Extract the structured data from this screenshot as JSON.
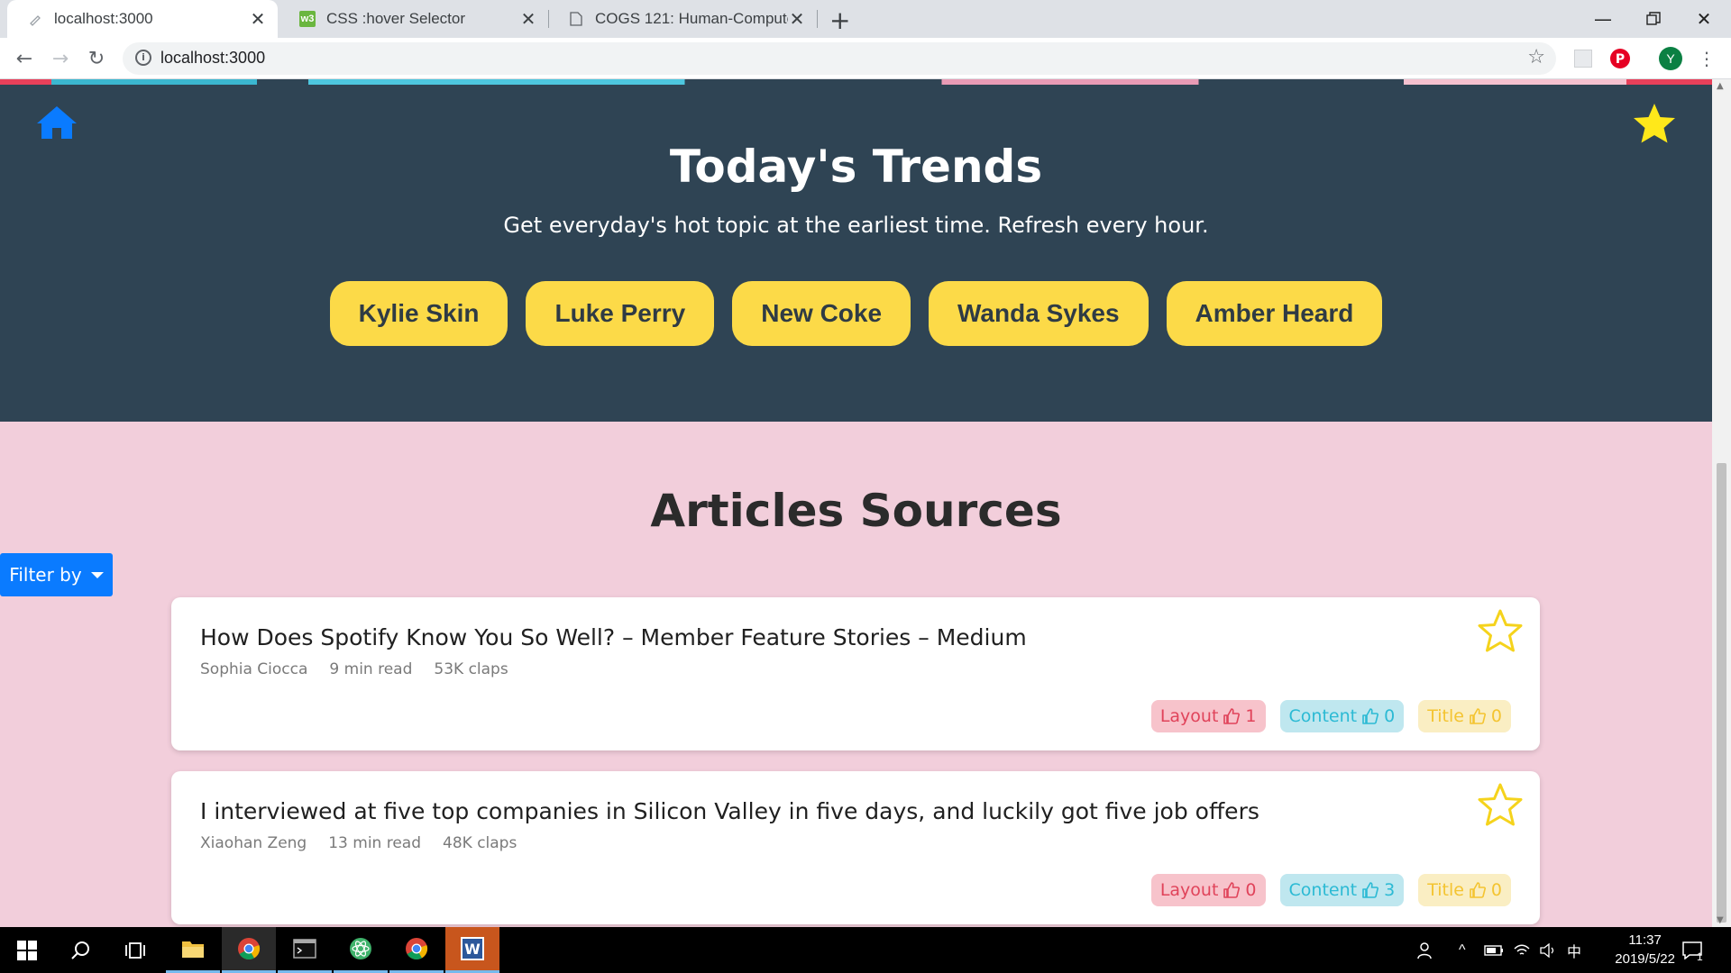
{
  "browser": {
    "tabs": [
      {
        "title": "localhost:3000"
      },
      {
        "title": "CSS :hover Selector"
      },
      {
        "title": "COGS 121: Human-Computer"
      }
    ],
    "url": "localhost:3000",
    "profile_initial": "Y"
  },
  "hero": {
    "title": "Today's Trends",
    "subtitle": "Get everyday's hot topic at the earliest time. Refresh every hour.",
    "trends": [
      "Kylie Skin",
      "Luke Perry",
      "New Coke",
      "Wanda Sykes",
      "Amber Heard"
    ]
  },
  "articles": {
    "section_title": "Articles Sources",
    "filter_label": "Filter by",
    "items": [
      {
        "title": "How Does Spotify Know You So Well? – Member Feature Stories – Medium",
        "author": "Sophia Ciocca",
        "read_time": "9 min read",
        "claps": "53K claps",
        "votes": {
          "layout_label": "Layout",
          "layout": "1",
          "content_label": "Content",
          "content": "0",
          "title_label": "Title",
          "title": "0"
        }
      },
      {
        "title": "I interviewed at five top companies in Silicon Valley in five days, and luckily got five job offers",
        "author": "Xiaohan Zeng",
        "read_time": "13 min read",
        "claps": "48K claps",
        "votes": {
          "layout_label": "Layout",
          "layout": "0",
          "content_label": "Content",
          "content": "3",
          "title_label": "Title",
          "title": "0"
        }
      }
    ]
  },
  "taskbar": {
    "time": "11:37",
    "date": "2019/5/22",
    "ime": "中",
    "notification_count": "1"
  },
  "colors": {
    "hero_bg": "#2f4454",
    "page_bg": "#f2cedb",
    "trend_button": "#fcda48",
    "home_icon": "#0a7bff",
    "star_filled": "#ffe81a",
    "star_outline": "#f5d31c",
    "filter_button": "#0a7bff"
  },
  "icons": [
    "home-icon",
    "star-icon",
    "star-outline-icon",
    "thumbs-up-icon",
    "caret-down-icon"
  ]
}
